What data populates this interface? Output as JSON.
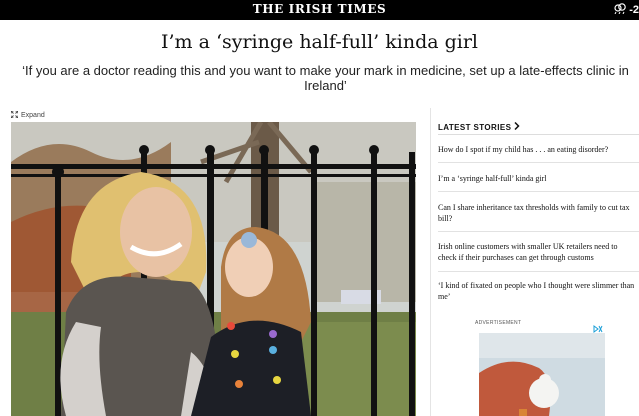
{
  "site": {
    "masthead": "THE IRISH TIMES",
    "weather_temp": "-2"
  },
  "article": {
    "headline": "I’m a ‘syringe half-full’ kinda girl",
    "standfirst": "‘If you are a doctor reading this and you want to make your mark in medicine, set up a late-effects clinic in Ireland’",
    "expand_label": "Expand"
  },
  "sidebar": {
    "title": "LATEST STORIES",
    "stories": [
      {
        "line1": "How do I spot if my child has . . . an eating disorder?",
        "line2": ""
      },
      {
        "line1": "I’m a ‘syringe half-full’ kinda girl",
        "line2": ""
      },
      {
        "line1": "Can I share inheritance tax thresholds with family to cut tax",
        "line2": "bill?"
      },
      {
        "line1": "Irish online customers with smaller UK retailers need to",
        "line2": "check if their purchases can get through customs"
      },
      {
        "line1": "‘I kind of fixated on people who I thought were slimmer than",
        "line2": "me’"
      }
    ]
  },
  "ad": {
    "label": "ADVERTISEMENT"
  },
  "colors": {
    "masthead_bg": "#000000",
    "ad_choices": "#1a9fd8"
  },
  "icons": {
    "weather": "weather-cloud-icon",
    "expand": "expand-arrows-icon",
    "chevron": "chevron-right-icon",
    "ad_choices": "adchoices-icon"
  }
}
